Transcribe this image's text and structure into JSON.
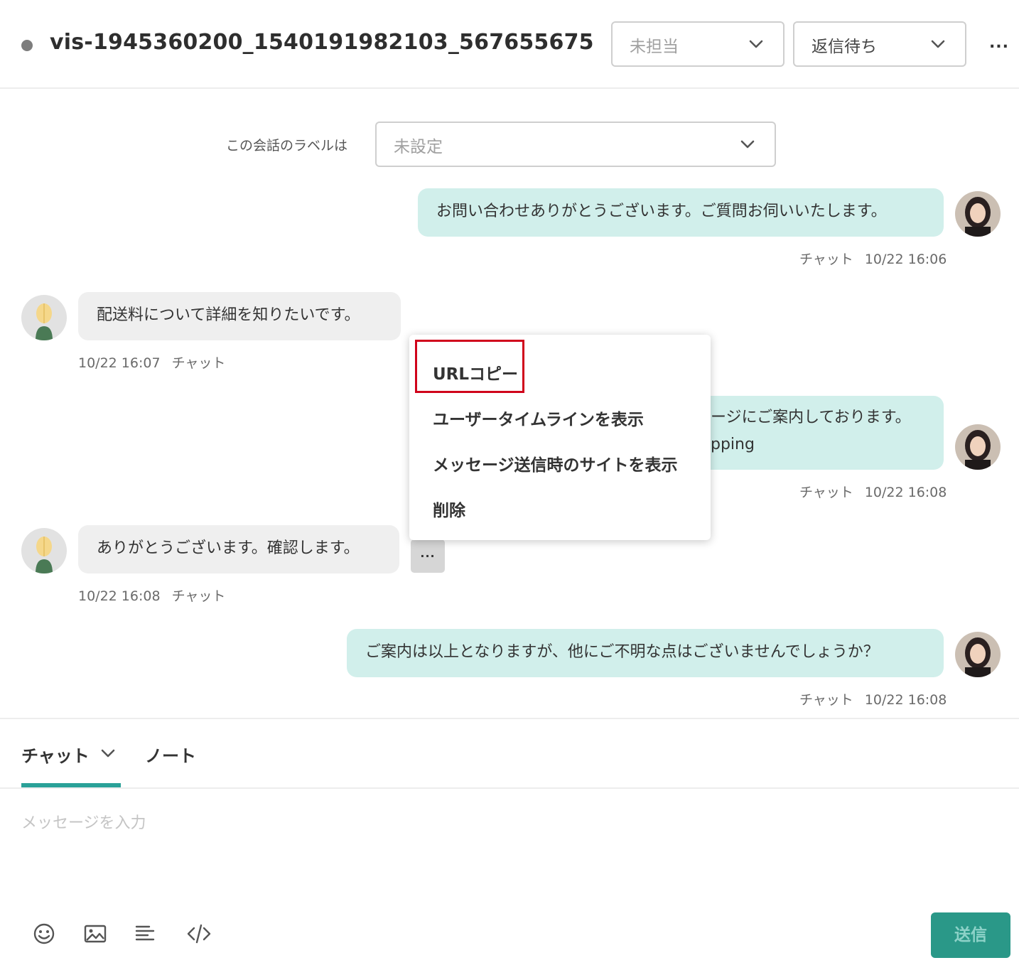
{
  "header": {
    "title": "vis-1945360200_1540191982103_567655675",
    "assignee": "未担当",
    "status": "返信待ち",
    "more": "..."
  },
  "label": {
    "caption": "この会話のラベルは",
    "value": "未設定"
  },
  "messages": [
    {
      "sender": "operator",
      "text": "お問い合わせありがとうございます。ご質問お伺いいたします。",
      "channel": "チャット",
      "time": "10/22 16:06"
    },
    {
      "sender": "visitor",
      "text": "配送料について詳細を知りたいです。",
      "channel": "チャット",
      "time": "10/22 16:07"
    },
    {
      "sender": "operator",
      "text_line1": "ージにご案内しております。",
      "text_line2": "pping",
      "channel": "チャット",
      "time": "10/22 16:08"
    },
    {
      "sender": "visitor",
      "text": "ありがとうございます。確認します。",
      "channel": "チャット",
      "time": "10/22 16:08"
    },
    {
      "sender": "operator",
      "text": "ご案内は以上となりますが、他にご不明な点はございませんでしょうか？",
      "channel": "チャット",
      "time": "10/22 16:08"
    }
  ],
  "message_more": "...",
  "context_menu": {
    "items": [
      "URLコピー",
      "ユーザータイムラインを表示",
      "メッセージ送信時のサイトを表示",
      "削除"
    ]
  },
  "composer": {
    "tabs": [
      "チャット",
      "ノート"
    ],
    "placeholder": "メッセージを入力",
    "send_label": "送信",
    "tools": [
      "emoji-icon",
      "image-icon",
      "template-icon",
      "code-icon"
    ]
  },
  "colors": {
    "accent": "#2aa198",
    "operator_bubble": "#d1efeb",
    "visitor_bubble": "#efefef",
    "send_button": "#2a9888",
    "highlight": "#d0021b"
  }
}
